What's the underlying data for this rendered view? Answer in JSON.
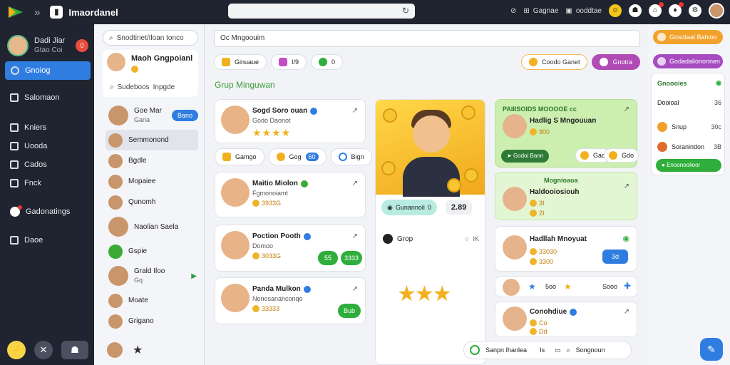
{
  "topbar": {
    "title": "Imaordanel",
    "right_items": [
      {
        "label": "Gagnae",
        "icon": "grid-icon"
      },
      {
        "label": "ooddtae",
        "icon": "image-icon"
      }
    ]
  },
  "sidebar": {
    "profile": {
      "name": "Dadi Jiar",
      "sub": "Gtao Coi",
      "badge": "0"
    },
    "nav": [
      {
        "label": "Gnoiog",
        "icon": "groups-icon",
        "active": true
      },
      {
        "label": "Salomaon",
        "icon": "store-icon",
        "active": false
      },
      {
        "label": "Kniers",
        "icon": "people-icon",
        "active": false
      },
      {
        "label": "Uooda",
        "icon": "book-icon",
        "active": false
      },
      {
        "label": "Cados",
        "icon": "pen-icon",
        "active": false
      },
      {
        "label": "Fnck",
        "icon": "folder-icon",
        "active": false
      },
      {
        "label": "Gadonatings",
        "icon": "notification-icon",
        "active": false
      },
      {
        "label": "Daoe",
        "icon": "monitor-icon",
        "active": false
      }
    ]
  },
  "col1": {
    "search_placeholder": "Snodtinet/Iloan tonco",
    "card": {
      "name": "Maoh Gngpoianl",
      "sub1": "Sudeboos",
      "sub2": "Inpgde"
    },
    "users": [
      {
        "name": "Goe Mar",
        "sub": "Gana",
        "button": "Bano"
      },
      {
        "name": "Semmonond",
        "selected": true
      },
      {
        "name": "Bgdle"
      },
      {
        "name": "Mopaiee"
      },
      {
        "name": "Qunomh"
      },
      {
        "name": "Naolian Saela",
        "big": true
      },
      {
        "name": "Gspie"
      },
      {
        "name": "Grald Iloo",
        "sub": "Gq",
        "big": true
      },
      {
        "name": "Moate"
      },
      {
        "name": "Grigano"
      }
    ]
  },
  "main": {
    "search_value": "Oc Mngoouim",
    "chips": [
      {
        "label": "Ginuaue",
        "icon": "crown-icon",
        "color": "#f2b01e"
      },
      {
        "label": "I/9",
        "icon": "gift-icon",
        "color": "#c24fc8"
      },
      {
        "label": "0",
        "icon": "globe-icon",
        "color": "#2fae3c"
      }
    ],
    "right_chips": [
      {
        "label": "Coodo Ganet",
        "style": "orange"
      },
      {
        "label": "Gnotra",
        "style": "purple"
      }
    ],
    "section_title": "Grup Minguwan",
    "feed": [
      {
        "name": "Sogd Soro ouan",
        "sub": "Godo Daonot",
        "stars": "★★★★"
      },
      {
        "name": "Maitio Miolon",
        "sub": "Fgmonoiamt",
        "coins": "3933G",
        "extra": "g"
      },
      {
        "name": "Poction Pooth",
        "sub": "Domoo",
        "coins": "3033G",
        "extra": "59",
        "btn1": "55",
        "btn2": "3333"
      },
      {
        "name": "Panda Mulkon",
        "sub": "Nonosananconqo",
        "coins": "33333",
        "extra": "1g",
        "btn1": "Bub"
      }
    ],
    "mini_chips": [
      {
        "label": "Gamgo",
        "icon": "bookmark-icon"
      },
      {
        "label": "Gog",
        "icon": "coin-icon",
        "value": "60"
      },
      {
        "label": "Bign",
        "icon": "gear-icon"
      }
    ],
    "hero": {
      "score_label": "Gunannoli",
      "score_num": "0",
      "score_value": "2.89",
      "grow_label": "Grop",
      "grow_right": "IK"
    },
    "right": [
      {
        "header": "PAIIISOIDS MOOOOE",
        "header_suffix": "cc",
        "name": "Hadlig S Mngouuan",
        "coins": "900",
        "pill1": "Godoi",
        "pill2": "Bann",
        "chip1": "Gao",
        "chip2": "Gdo"
      },
      {
        "header": "Mognioaoa",
        "name": "Haldooiosiouh",
        "coins": "3I",
        "sub": "2I"
      },
      {
        "name": "Hadllah Mnoyuat",
        "coins": "33030",
        "sub": "3300",
        "btn": "3d"
      },
      {
        "left": "Ee",
        "mid": "5oo",
        "right": "Sooo"
      },
      {
        "name": "Conohdiue",
        "coins": "Co",
        "sub": "Dd"
      }
    ],
    "bottom": {
      "label": "Sanpn Ihanlea",
      "mid": "Is",
      "right": "Songnoun"
    }
  },
  "rpanel": {
    "btn1": "Gosdtaal Bahioo",
    "btn2": "Godadaliononnen",
    "box_title": "Gnoooies",
    "rows": [
      {
        "label": "Dooioal",
        "value": "36"
      },
      {
        "label": "Snup",
        "value": "30c"
      },
      {
        "label": "Soranindon",
        "value": "3B"
      }
    ],
    "pill": "Enoonoolioor"
  }
}
